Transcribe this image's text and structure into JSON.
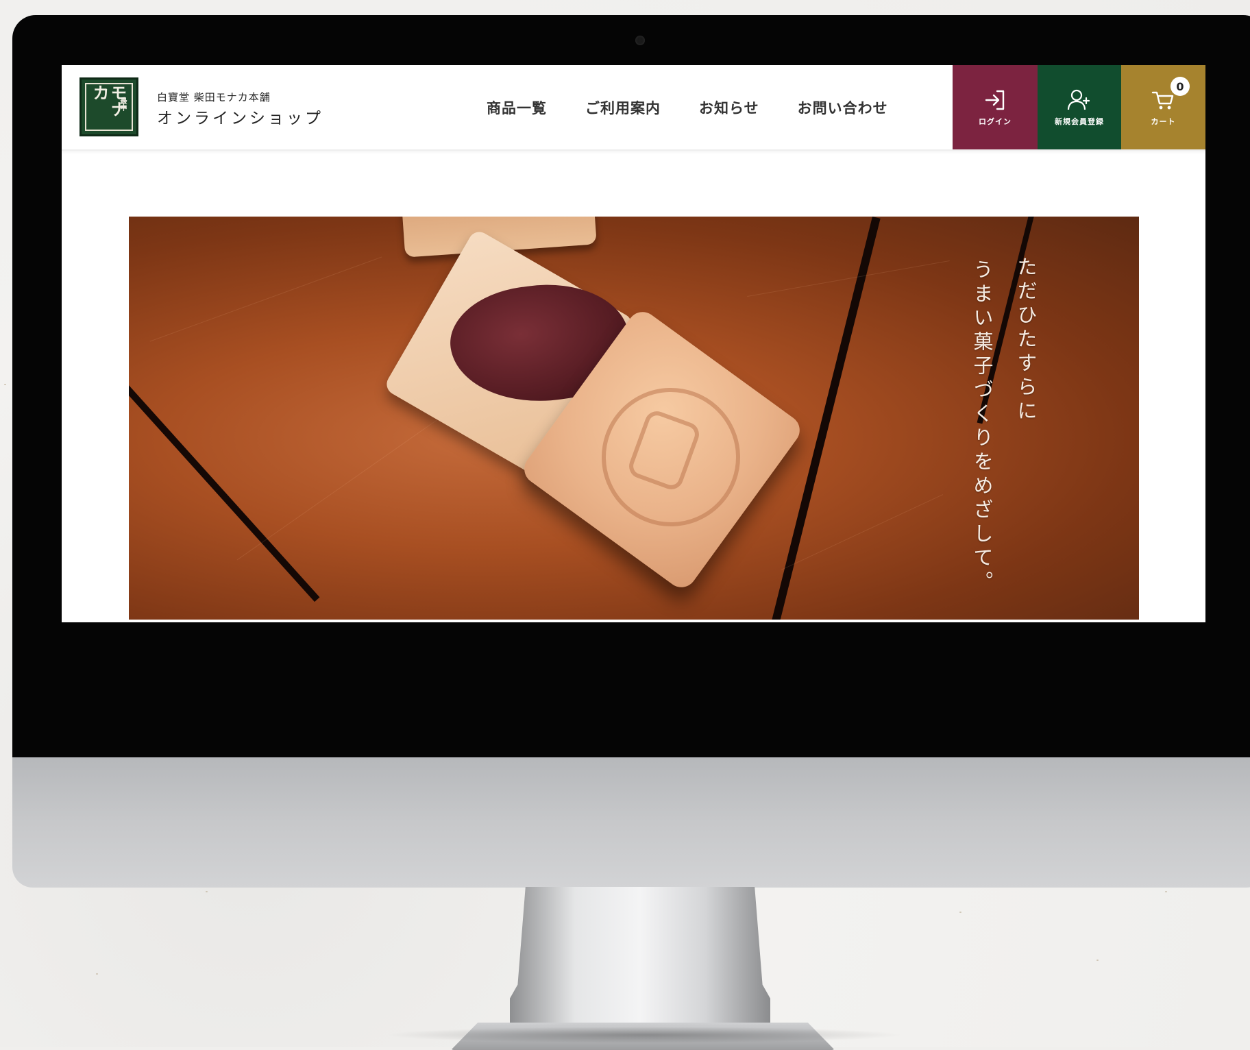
{
  "header": {
    "brand_sub": "白寶堂 柴田モナカ本舗",
    "brand_main": "オンラインショップ",
    "logo_text_main": "モナカ",
    "logo_text_small": "最中"
  },
  "nav": {
    "items": [
      {
        "label": "商品一覧"
      },
      {
        "label": "ご利用案内"
      },
      {
        "label": "お知らせ"
      },
      {
        "label": "お問い合わせ"
      }
    ]
  },
  "actions": {
    "login_label": "ログイン",
    "signup_label": "新規会員登録",
    "cart_label": "カート",
    "cart_count": "0"
  },
  "hero": {
    "catch_line1": "ただひたすらに",
    "catch_line2": "うまい菓子づくりをめざして。"
  },
  "colors": {
    "login_bg": "#7c2340",
    "signup_bg": "#114d2e",
    "cart_bg": "#a6832e",
    "logo_bg": "#1d4a2b"
  },
  "icons": {
    "login": "login-arrow-icon",
    "signup": "user-plus-icon",
    "cart": "cart-icon"
  }
}
